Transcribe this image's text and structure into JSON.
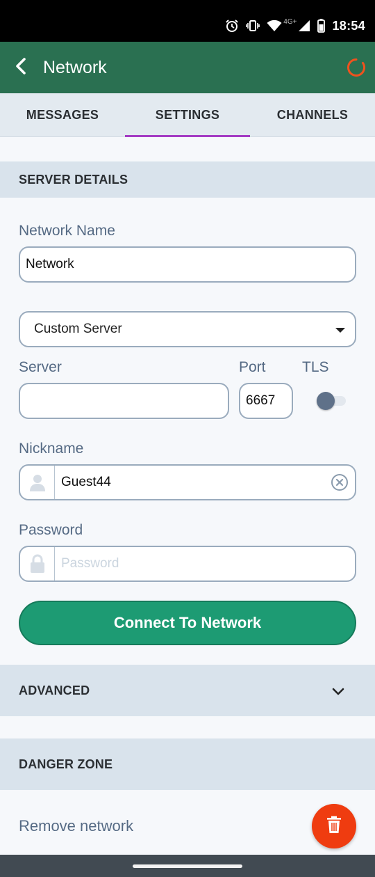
{
  "status_bar": {
    "time": "18:54",
    "network_type": "4G+",
    "icons": [
      "alarm-icon",
      "vibrate-icon",
      "wifi-icon",
      "signal-icon",
      "battery-icon"
    ]
  },
  "app_bar": {
    "title": "Network",
    "back_icon": "chevron-left-icon",
    "status_icon": "connection-ring-icon",
    "status_color": "#f0521e"
  },
  "tabs": [
    {
      "label": "MESSAGES",
      "active": false
    },
    {
      "label": "SETTINGS",
      "active": true
    },
    {
      "label": "CHANNELS",
      "active": false
    }
  ],
  "server_details": {
    "header": "SERVER DETAILS",
    "network_name": {
      "label": "Network Name",
      "value": "Network"
    },
    "server_type": {
      "selected": "Custom Server"
    },
    "server": {
      "label": "Server",
      "value": ""
    },
    "port": {
      "label": "Port",
      "value": "6667"
    },
    "tls": {
      "label": "TLS",
      "enabled": false
    },
    "nickname": {
      "label": "Nickname",
      "value": "Guest44",
      "icon": "person-icon",
      "clear_icon": "clear-circle-icon"
    },
    "password": {
      "label": "Password",
      "placeholder": "Password",
      "icon": "lock-icon"
    },
    "connect_button": "Connect To Network"
  },
  "advanced": {
    "header": "ADVANCED",
    "icon": "chevron-down-icon"
  },
  "danger_zone": {
    "header": "DANGER ZONE",
    "remove_label": "Remove network",
    "delete_icon": "trash-icon"
  },
  "colors": {
    "app_bar": "#2a7051",
    "accent_tab": "#a43cc4",
    "primary_button": "#1d9b73",
    "danger": "#ef3c10"
  }
}
